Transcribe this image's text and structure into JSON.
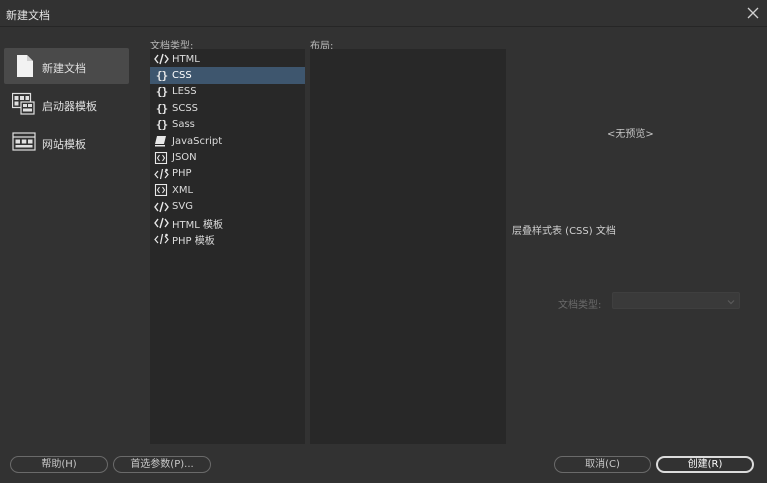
{
  "window": {
    "title": "新建文档"
  },
  "sidebar": {
    "items": [
      {
        "label": "新建文档",
        "icon": "new-document-icon",
        "active": true
      },
      {
        "label": "启动器模板",
        "icon": "starter-template-icon",
        "active": false
      },
      {
        "label": "网站模板",
        "icon": "site-template-icon",
        "active": false
      }
    ]
  },
  "doc_types": {
    "heading": "文档类型:",
    "items": [
      {
        "label": "HTML",
        "icon": "code-tag-icon"
      },
      {
        "label": "CSS",
        "icon": "curly-braces-icon",
        "selected": true
      },
      {
        "label": "LESS",
        "icon": "curly-braces-icon"
      },
      {
        "label": "SCSS",
        "icon": "curly-braces-icon"
      },
      {
        "label": "Sass",
        "icon": "curly-braces-icon"
      },
      {
        "label": "JavaScript",
        "icon": "javascript-scroll-icon"
      },
      {
        "label": "JSON",
        "icon": "json-file-icon"
      },
      {
        "label": "PHP",
        "icon": "php-icon"
      },
      {
        "label": "XML",
        "icon": "xml-file-icon"
      },
      {
        "label": "SVG",
        "icon": "code-tag-icon"
      },
      {
        "label": "HTML 模板",
        "icon": "code-tag-icon"
      },
      {
        "label": "PHP 模板",
        "icon": "php-icon"
      }
    ]
  },
  "layout": {
    "heading": "布局:"
  },
  "preview": {
    "no_preview": "<无预览>",
    "description": "层叠样式表 (CSS) 文档",
    "doctype_label": "文档类型:",
    "doctype_value": ""
  },
  "buttons": {
    "help": "帮助(H)",
    "preferences": "首选参数(P)...",
    "cancel": "取消(C)",
    "create": "创建(R)"
  },
  "colors": {
    "background": "#323232",
    "panel": "#282828",
    "selection": "#3e566e",
    "sidebar_active": "#4a4a4a"
  }
}
